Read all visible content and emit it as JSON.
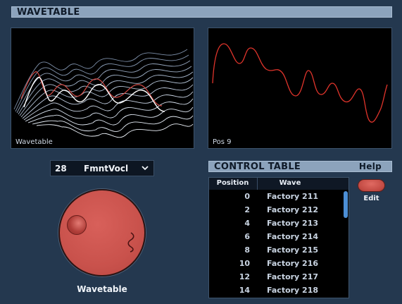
{
  "wavetable_section": {
    "title": "WAVETABLE",
    "display_label": "Wavetable",
    "position_label": "Pos 9"
  },
  "wave_select": {
    "number": "28",
    "name": "FmntVocl",
    "chevron_icon": "chevron-down-icon"
  },
  "knob": {
    "label": "Wavetable",
    "color": "#c9524c"
  },
  "control_table": {
    "title": "CONTROL TABLE",
    "help_label": "Help",
    "columns": [
      "Position",
      "Wave"
    ],
    "rows": [
      {
        "position": "0",
        "wave": "Factory 211"
      },
      {
        "position": "2",
        "wave": "Factory 212"
      },
      {
        "position": "4",
        "wave": "Factory 213"
      },
      {
        "position": "6",
        "wave": "Factory 214"
      },
      {
        "position": "8",
        "wave": "Factory 215"
      },
      {
        "position": "10",
        "wave": "Factory 216"
      },
      {
        "position": "12",
        "wave": "Factory 217"
      },
      {
        "position": "14",
        "wave": "Factory 218"
      }
    ]
  },
  "edit_button": {
    "label": "Edit"
  },
  "colors": {
    "background": "#24384f",
    "header": "#8ca3bc",
    "accent_red": "#c9524c",
    "wave_trace": "#e0342b",
    "scrollbar": "#4c8fd6"
  }
}
